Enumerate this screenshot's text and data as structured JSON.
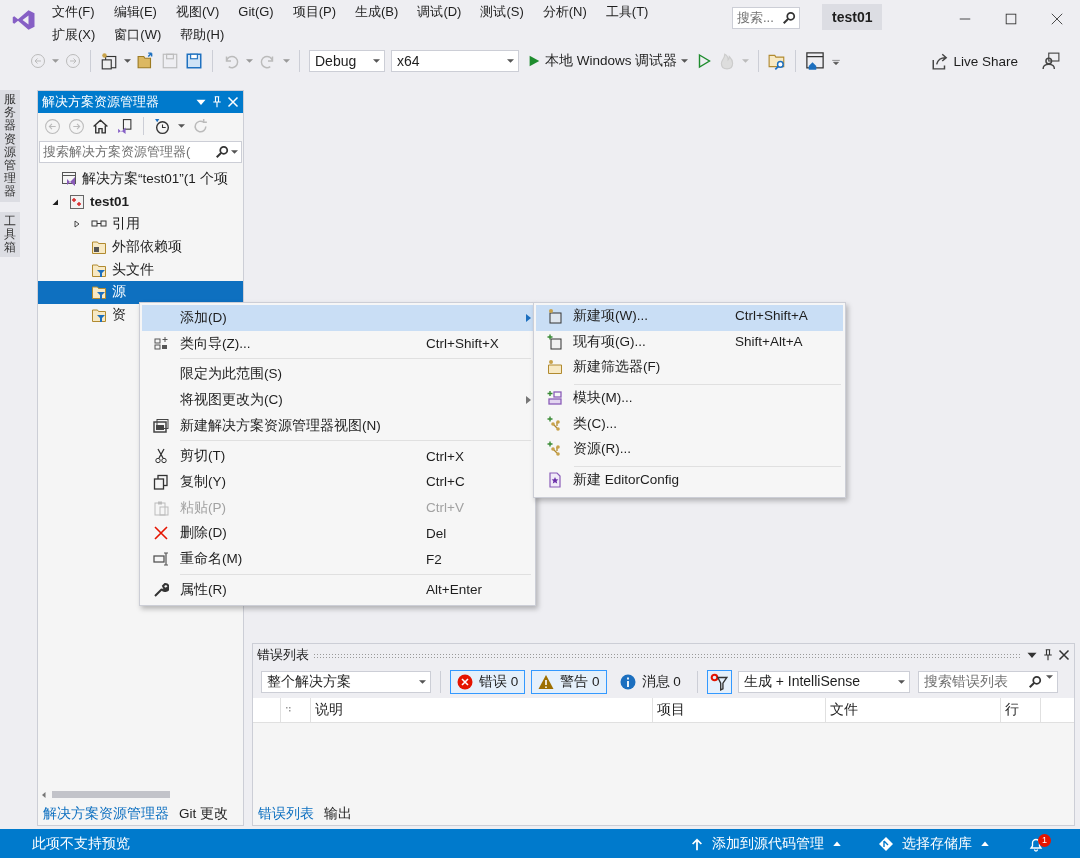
{
  "window": {
    "title": "test01"
  },
  "menu_rows": [
    [
      "文件(F)",
      "编辑(E)",
      "视图(V)",
      "Git(G)",
      "项目(P)",
      "生成(B)",
      "调试(D)",
      "测试(S)",
      "分析(N)",
      "工具(T)"
    ],
    [
      "扩展(X)",
      "窗口(W)",
      "帮助(H)"
    ]
  ],
  "search": {
    "placeholder": "搜索..."
  },
  "toolbar": {
    "configuration": "Debug",
    "platform": "x64",
    "debugger": "本地 Windows 调试器",
    "live_share": "Live Share"
  },
  "side_tabs": [
    "服务器资源管理器",
    "工具箱"
  ],
  "solution_explorer": {
    "title": "解决方案资源管理器",
    "search_placeholder": "搜索解决方案资源管理器(",
    "tree": [
      {
        "label": "解决方案“test01”(1 个项",
        "kind": "solution",
        "selected": false,
        "children": [
          {
            "label": "test01",
            "kind": "project",
            "expanded": true,
            "selected": false,
            "children": [
              {
                "label": "引用",
                "kind": "references",
                "expanded": false,
                "selected": false
              },
              {
                "label": "外部依赖项",
                "kind": "external",
                "selected": false
              },
              {
                "label": "头文件",
                "kind": "filter",
                "selected": false
              },
              {
                "label": "源",
                "kind": "filter",
                "selected": true
              },
              {
                "label": "资",
                "kind": "filter",
                "selected": false
              }
            ]
          }
        ]
      }
    ],
    "tabs": [
      {
        "label": "解决方案资源管理器",
        "selected": true
      },
      {
        "label": "Git 更改",
        "selected": false
      }
    ]
  },
  "context_menu": {
    "items": [
      {
        "kind": "item",
        "label": "添加(D)",
        "has_submenu": true,
        "selected": true,
        "disabled": false
      },
      {
        "kind": "item",
        "label": "类向导(Z)...",
        "shortcut": "Ctrl+Shift+X",
        "selected": false,
        "disabled": false
      },
      {
        "kind": "separator"
      },
      {
        "kind": "item",
        "label": "限定为此范围(S)",
        "selected": false,
        "disabled": false
      },
      {
        "kind": "item",
        "label": "将视图更改为(C)",
        "has_submenu": true,
        "selected": false,
        "disabled": false
      },
      {
        "kind": "item",
        "label": "新建解决方案资源管理器视图(N)",
        "selected": false,
        "disabled": false
      },
      {
        "kind": "separator"
      },
      {
        "kind": "item",
        "label": "剪切(T)",
        "shortcut": "Ctrl+X",
        "selected": false,
        "disabled": false
      },
      {
        "kind": "item",
        "label": "复制(Y)",
        "shortcut": "Ctrl+C",
        "selected": false,
        "disabled": false
      },
      {
        "kind": "item",
        "label": "粘贴(P)",
        "shortcut": "Ctrl+V",
        "selected": false,
        "disabled": true
      },
      {
        "kind": "item",
        "label": "删除(D)",
        "shortcut": "Del",
        "selected": false,
        "disabled": false
      },
      {
        "kind": "item",
        "label": "重命名(M)",
        "shortcut": "F2",
        "selected": false,
        "disabled": false
      },
      {
        "kind": "separator"
      },
      {
        "kind": "item",
        "label": "属性(R)",
        "shortcut": "Alt+Enter",
        "selected": false,
        "disabled": false
      }
    ]
  },
  "submenu": {
    "items": [
      {
        "kind": "item",
        "label": "新建项(W)...",
        "shortcut": "Ctrl+Shift+A",
        "selected": true,
        "disabled": false
      },
      {
        "kind": "item",
        "label": "现有项(G)...",
        "shortcut": "Shift+Alt+A",
        "selected": false,
        "disabled": false
      },
      {
        "kind": "item",
        "label": "新建筛选器(F)",
        "selected": false,
        "disabled": false
      },
      {
        "kind": "separator"
      },
      {
        "kind": "item",
        "label": "模块(M)...",
        "selected": false,
        "disabled": false
      },
      {
        "kind": "item",
        "label": "类(C)...",
        "selected": false,
        "disabled": false
      },
      {
        "kind": "item",
        "label": "资源(R)...",
        "selected": false,
        "disabled": false
      },
      {
        "kind": "separator"
      },
      {
        "kind": "item",
        "label": "新建 EditorConfig",
        "selected": false,
        "disabled": false
      }
    ]
  },
  "error_list": {
    "title": "错误列表",
    "scope": "整个解决方案",
    "filters": [
      {
        "kind": "error",
        "label": "错误 0",
        "on": true
      },
      {
        "kind": "warning",
        "label": "警告 0",
        "on": true
      },
      {
        "kind": "message",
        "label": "消息 0",
        "on": false
      }
    ],
    "filter_button_on": true,
    "source": "生成 + IntelliSense",
    "search_placeholder": "搜索错误列表",
    "columns": [
      "说明",
      "项目",
      "文件",
      "行"
    ],
    "tabs": [
      {
        "label": "错误列表",
        "selected": true
      },
      {
        "label": "输出",
        "selected": false
      }
    ]
  },
  "status_bar": {
    "message": "此项不支持预览",
    "source_control": "添加到源代码管理",
    "repository": "选择存储库",
    "notifications": "1"
  }
}
